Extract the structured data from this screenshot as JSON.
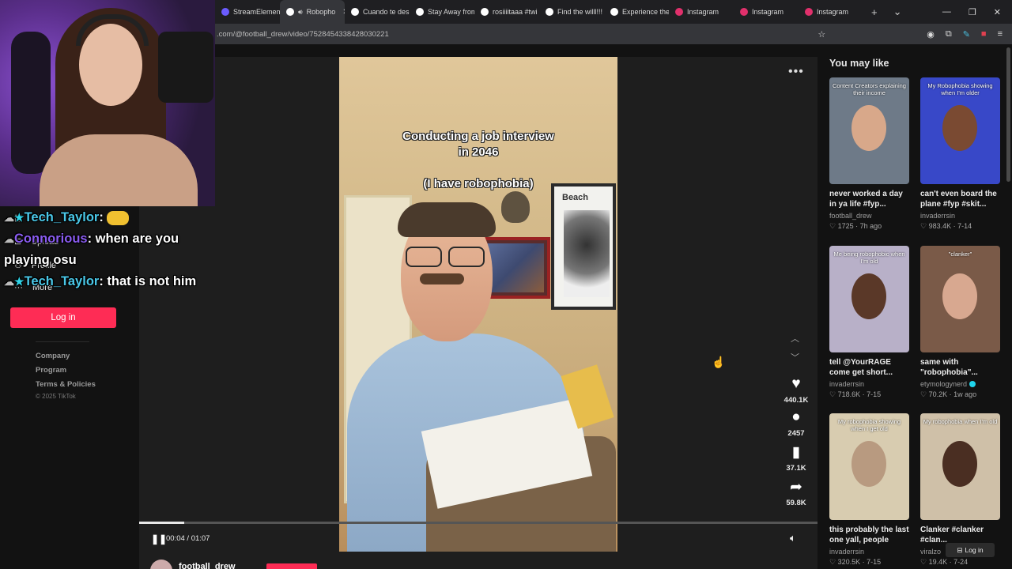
{
  "browser": {
    "tabs": [
      {
        "label": "StreamElement",
        "favicon_color": "#6b5cff",
        "active": false
      },
      {
        "label": "Robopho",
        "favicon_color": "#ffffff",
        "active": true
      },
      {
        "label": "Cuando te desp",
        "favicon_color": "#ffffff",
        "active": false
      },
      {
        "label": "Stay Away from",
        "favicon_color": "#ffffff",
        "active": false
      },
      {
        "label": "rosiiiitaaa #twi",
        "favicon_color": "#ffffff",
        "active": false
      },
      {
        "label": "Find the willl!!!",
        "favicon_color": "#ffffff",
        "active": false
      },
      {
        "label": "Experience the",
        "favicon_color": "#ffffff",
        "active": false
      },
      {
        "label": "Instagram",
        "favicon_color": "#e1306c",
        "active": false
      },
      {
        "label": "Instagram",
        "favicon_color": "#e1306c",
        "active": false
      },
      {
        "label": "Instagram",
        "favicon_color": "#e1306c",
        "active": false
      }
    ],
    "new_tab": "+",
    "tab_menu": "⌄",
    "url": ".com/@football_drew/video/7528454338428030221"
  },
  "sidebar": {
    "items": [
      {
        "label": "Live",
        "icon": "live-icon"
      },
      {
        "label": "Upload",
        "icon": "upload-icon"
      },
      {
        "label": "Profile",
        "icon": "profile-icon"
      },
      {
        "label": "More",
        "icon": "more-icon"
      }
    ],
    "login_label": "Log in",
    "footer": [
      "Company",
      "Program",
      "Terms & Policies"
    ],
    "copyright": "© 2025 TikTok"
  },
  "video": {
    "caption_line1": "Conducting a job interview",
    "caption_line2": "in 2046",
    "caption_line3": "(I have robophobia)",
    "wall_sign": "Beach",
    "likes": "440.1K",
    "comments": "2457",
    "saves": "37.1K",
    "shares": "59.8K",
    "time": "00:04 / 01:07",
    "progress": 0.066,
    "author": "football_drew"
  },
  "recommended": {
    "title": "You may like",
    "cards": [
      {
        "caption": "Content Creators explaining their income",
        "title": "never worked a day in ya life #fyp...",
        "author": "football_drew",
        "likes": "1725",
        "date": "7h ago",
        "verified": false,
        "bg": "#6e7a88",
        "face": "#d8a88a"
      },
      {
        "caption": "My Robophobia showing when I'm older",
        "title": "can't even board the plane #fyp #skit...",
        "author": "invaderrsin",
        "likes": "983.4K",
        "date": "7-14",
        "verified": false,
        "bg": "#3848c8",
        "face": "#7a4a32"
      },
      {
        "caption": "Me being robophobic when I'm old",
        "title": "tell @YourRAGE come get short...",
        "author": "invaderrsin",
        "likes": "718.6K",
        "date": "7-15",
        "verified": false,
        "bg": "#b8b0c8",
        "face": "#5a3828"
      },
      {
        "caption": "\"clanker\"",
        "title": "same with \"robophobia\"...",
        "author": "etymologynerd",
        "likes": "70.2K",
        "date": "1w ago",
        "verified": true,
        "bg": "#7a5a48",
        "face": "#d8a890"
      },
      {
        "caption": "My robophobia showing when I get old",
        "title": "this probably the last one yall, people are...",
        "author": "invaderrsin",
        "likes": "320.5K",
        "date": "7-15",
        "verified": false,
        "bg": "#d8ccb0",
        "face": "#b89a80"
      },
      {
        "caption": "My robophobia when I'm old",
        "title": "Clanker #clanker #clan...",
        "author": "viralzo",
        "likes": "19.4K",
        "date": "7-24",
        "verified": false,
        "bg": "#cfc0a8",
        "face": "#4a2e22"
      }
    ],
    "login_label": "Log in"
  },
  "chat": {
    "messages": [
      {
        "user": "Tech_Taylor",
        "text": "",
        "emote": true
      },
      {
        "user": "Connorious",
        "text": "when are you playing osu",
        "emote": false
      },
      {
        "user": "Tech_Taylor",
        "text": "that is not him",
        "emote": false
      }
    ]
  }
}
